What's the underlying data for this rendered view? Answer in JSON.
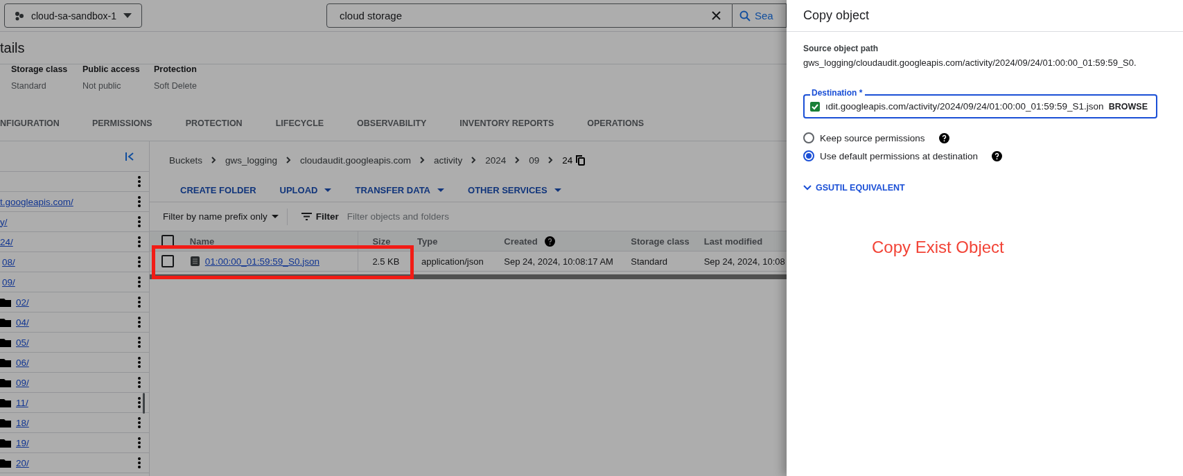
{
  "top_bar": {
    "project": "cloud-sa-sandbox-1",
    "search": {
      "value": "cloud storage"
    },
    "search_button": "Sea"
  },
  "heading": "tails",
  "details": [
    {
      "label": "Storage class",
      "value": "Standard"
    },
    {
      "label": "Public access",
      "value": "Not public"
    },
    {
      "label": "Protection",
      "value": "Soft Delete"
    }
  ],
  "tabs": [
    {
      "label": "NFIGURATION",
      "selected": false
    },
    {
      "label": "PERMISSIONS",
      "selected": false
    },
    {
      "label": "PROTECTION",
      "selected": false
    },
    {
      "label": "LIFECYCLE",
      "selected": false
    },
    {
      "label": "OBSERVABILITY",
      "selected": false
    },
    {
      "label": "INVENTORY REPORTS",
      "selected": false
    },
    {
      "label": "OPERATIONS",
      "selected": false
    }
  ],
  "sidebar": {
    "items": [
      {
        "children": [
          {
            "label": "t.googleapis.com/",
            "children": [
              {
                "label": "y/",
                "children": [
                  {
                    "label": "24/",
                    "children": [
                      {
                        "label": "08/"
                      },
                      {
                        "label": "09/",
                        "children": [
                          {
                            "label": "02/"
                          },
                          {
                            "label": "04/"
                          },
                          {
                            "label": "05/"
                          },
                          {
                            "label": "06/"
                          },
                          {
                            "label": "09/"
                          },
                          {
                            "label": "11/"
                          },
                          {
                            "label": "18/"
                          },
                          {
                            "label": "19/"
                          },
                          {
                            "label": "20/"
                          }
                        ]
                      }
                    ]
                  }
                ]
              }
            ]
          }
        ]
      }
    ]
  },
  "breadcrumb": [
    "Buckets",
    "gws_logging",
    "cloudaudit.googleapis.com",
    "activity",
    "2024",
    "09",
    "24"
  ],
  "toolbar": [
    {
      "label": "CREATE FOLDER",
      "dropdown": false
    },
    {
      "label": "UPLOAD",
      "dropdown": true
    },
    {
      "label": "TRANSFER DATA",
      "dropdown": true
    },
    {
      "label": "OTHER SERVICES",
      "dropdown": true
    }
  ],
  "filter_bar": {
    "mode": "Filter by name prefix only",
    "filter_label": "Filter",
    "placeholder": "Filter objects and folders"
  },
  "table": {
    "all_selected": false,
    "columns": [
      {
        "label": "Name",
        "help": false
      },
      {
        "label": "Size",
        "help": false
      },
      {
        "label": "Type",
        "help": false
      },
      {
        "label": "Created",
        "help": true
      },
      {
        "label": "Storage class",
        "help": false
      },
      {
        "label": "Last modified",
        "help": false
      }
    ],
    "rows": [
      {
        "checked": false,
        "highlighted": true,
        "cells": [
          "01:00:00_01:59:59_S0.json",
          "2.5 KB",
          "application/json",
          "Sep 24, 2024, 10:08:17 AM",
          "Standard",
          "Sep 24, 2024, 10:08"
        ]
      }
    ]
  },
  "annotation": {
    "text": "Copy Exist Object"
  },
  "panel": {
    "title": "Copy object",
    "source_label": "Source object path",
    "source_path": "gws_logging/cloudaudit.googleapis.com/activity/2024/09/24/01:00:00_01:59:59_S0.",
    "destination": {
      "label": "Destination *",
      "valid": true,
      "value": "ıdit.googleapis.com/activity/2024/09/24/01:00:00_01:59:59_S1.json",
      "browse": "BROWSE"
    },
    "options": [
      {
        "label": "Keep source permissions",
        "selected": false
      },
      {
        "label": "Use default permissions at destination",
        "selected": true
      }
    ],
    "gsutil": {
      "label": "GSUTIL EQUIVALENT",
      "expanded": false
    }
  }
}
